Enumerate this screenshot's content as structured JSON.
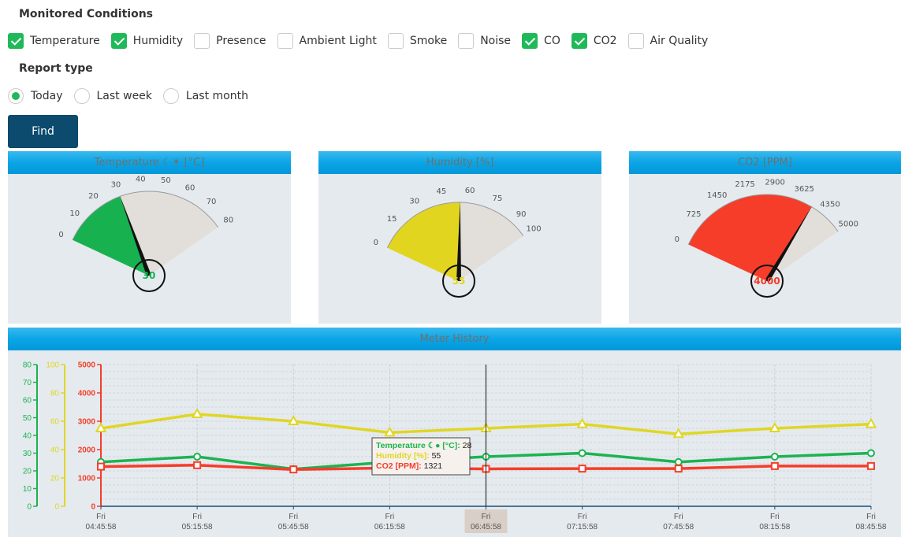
{
  "conditions": {
    "title": "Monitored Conditions",
    "items": [
      {
        "label": "Temperature",
        "checked": true
      },
      {
        "label": "Humidity",
        "checked": true
      },
      {
        "label": "Presence",
        "checked": false
      },
      {
        "label": "Ambient Light",
        "checked": false
      },
      {
        "label": "Smoke",
        "checked": false
      },
      {
        "label": "Noise",
        "checked": false
      },
      {
        "label": "CO",
        "checked": true
      },
      {
        "label": "CO2",
        "checked": true
      },
      {
        "label": "Air Quality",
        "checked": false
      }
    ]
  },
  "report": {
    "title": "Report type",
    "options": [
      {
        "label": "Today",
        "selected": true
      },
      {
        "label": "Last week",
        "selected": false
      },
      {
        "label": "Last month",
        "selected": false
      }
    ]
  },
  "find_label": "Find",
  "colors": {
    "accent_green": "#1fb95a",
    "button": "#0c4a6e",
    "header_blue": "#0ba5e6",
    "temperature": "#1cb351",
    "humidity": "#e0d624",
    "co2": "#f53d2a"
  },
  "gauges": [
    {
      "title": "Temperature ☾☀ [°C]",
      "min": 0,
      "max": 80,
      "value": 30,
      "value_label": "30",
      "ticks": [
        "0",
        "10",
        "20",
        "30",
        "40",
        "50",
        "60",
        "70",
        "80"
      ],
      "color": "#17b24f",
      "label_color": "#17b24f"
    },
    {
      "title": "Humidity [%]",
      "min": 0,
      "max": 100,
      "value": 55,
      "value_label": "55",
      "ticks": [
        "0",
        "15",
        "30",
        "45",
        "60",
        "75",
        "90",
        "100"
      ],
      "tick_values": [
        0,
        15,
        30,
        45,
        60,
        75,
        90,
        100
      ],
      "color": "#e1d520",
      "label_color": "#e1d520"
    },
    {
      "title": "CO2 [PPM]",
      "min": 0,
      "max": 5000,
      "value": 4000,
      "value_label": "4000",
      "ticks": [
        "0",
        "725",
        "1450",
        "2175",
        "2900",
        "3625",
        "4350",
        "5000"
      ],
      "tick_values": [
        0,
        725,
        1450,
        2175,
        2900,
        3625,
        4350,
        5000
      ],
      "color": "#f53d2a",
      "label_color": "#f53d2a"
    }
  ],
  "history": {
    "title": "Meter History",
    "axes": {
      "temperature": {
        "min": 0,
        "max": 80,
        "ticks": [
          "0",
          "10",
          "20",
          "30",
          "40",
          "50",
          "60",
          "70",
          "80"
        ],
        "color": "#1cb351"
      },
      "humidity": {
        "min": 0,
        "max": 100,
        "ticks": [
          "0",
          "20",
          "40",
          "60",
          "80",
          "100"
        ],
        "color": "#e0d624"
      },
      "co2": {
        "min": 0,
        "max": 5000,
        "ticks": [
          "0",
          "1000",
          "2000",
          "3000",
          "4000",
          "5000"
        ],
        "color": "#f53d2a"
      }
    },
    "x_day": "Fri",
    "x_times": [
      "04:45:58",
      "05:15:58",
      "05:45:58",
      "06:15:58",
      "06:45:58",
      "07:15:58",
      "07:45:58",
      "08:15:58",
      "08:45:58"
    ],
    "highlight_index": 4,
    "tooltip": {
      "temperature_label": "Temperature ☾● [°C]:",
      "temperature_value": "28",
      "humidity_label": "Humidity [%]:",
      "humidity_value": "55",
      "co2_label": "CO2 [PPM]:",
      "co2_value": "1321"
    }
  },
  "chart_data": {
    "type": "line",
    "x": [
      "Fri 04:45:58",
      "Fri 05:15:58",
      "Fri 05:45:58",
      "Fri 06:15:58",
      "Fri 06:45:58",
      "Fri 07:15:58",
      "Fri 07:45:58",
      "Fri 08:15:58",
      "Fri 08:45:58"
    ],
    "series": [
      {
        "name": "Temperature ☾● [°C]",
        "axis": "left-1",
        "values": [
          25,
          28,
          21,
          25,
          28,
          30,
          25,
          28,
          30
        ]
      },
      {
        "name": "Humidity [%]",
        "axis": "left-2",
        "values": [
          55,
          65,
          60,
          52,
          55,
          58,
          51,
          55,
          58
        ]
      },
      {
        "name": "CO2 [PPM]",
        "axis": "left-3",
        "values": [
          1400,
          1450,
          1300,
          1350,
          1321,
          1330,
          1330,
          1420,
          1420
        ]
      }
    ],
    "ylims": {
      "temperature": [
        0,
        80
      ],
      "humidity": [
        0,
        100
      ],
      "co2": [
        0,
        5000
      ]
    },
    "title": "Meter History",
    "grid": true
  }
}
